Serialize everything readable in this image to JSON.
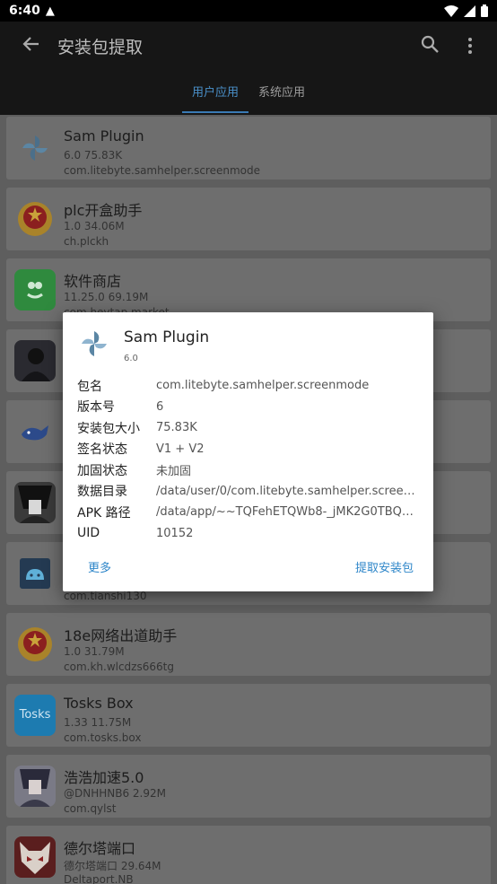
{
  "status_bar": {
    "time": "6:40"
  },
  "app_bar": {
    "title": "安装包提取"
  },
  "tabs": [
    {
      "label": "用户应用",
      "active": true
    },
    {
      "label": "系统应用",
      "active": false
    }
  ],
  "apps": [
    {
      "name": "Sam Plugin",
      "version_size": "6.0  75.83K",
      "package": "com.litebyte.samhelper.screenmode",
      "icon": "pinwheel-icon"
    },
    {
      "name": "plc开盒助手",
      "version_size": "1.0  34.06M",
      "package": "ch.plckh",
      "icon": "emblem-icon"
    },
    {
      "name": "软件商店",
      "version_size": "11.25.0  69.19M",
      "package": "com.heytap.market",
      "icon": "store-icon"
    },
    {
      "name": "",
      "version_size": "",
      "package": "",
      "icon": "avatar-icon"
    },
    {
      "name": "",
      "version_size": "",
      "package": "",
      "icon": "whale-icon"
    },
    {
      "name": "",
      "version_size": "",
      "package": "",
      "icon": "anime-avatar-icon"
    },
    {
      "name": "",
      "version_size": "",
      "package": "com.tianshi130",
      "icon": "android-icon"
    },
    {
      "name": "18e网络出道助手",
      "version_size": "1.0  31.79M",
      "package": "com.kh.wlcdzs666tg",
      "icon": "emblem-icon"
    },
    {
      "name": "Tosks Box",
      "version_size": "1.33  11.75M",
      "package": "com.tosks.box",
      "icon": "tosks-icon",
      "icon_text": "Tosks"
    },
    {
      "name": "浩浩加速5.0",
      "version_size": "@DNHHNB6  2.92M",
      "package": "com.qylst",
      "icon": "anime-avatar-icon"
    },
    {
      "name": "德尔塔端口",
      "version_size": "德尔塔端口  29.64M",
      "package": "Deltaport.NB",
      "icon": "fox-icon"
    }
  ],
  "dialog": {
    "title": "Sam Plugin",
    "version": "6.0",
    "rows": [
      {
        "key": "包名",
        "value": "com.litebyte.samhelper.screenmode"
      },
      {
        "key": "版本号",
        "value": "6"
      },
      {
        "key": "安装包大小",
        "value": "75.83K"
      },
      {
        "key": "签名状态",
        "value": "V1 + V2"
      },
      {
        "key": "加固状态",
        "value": "未加固"
      },
      {
        "key": "数据目录",
        "value": "/data/user/0/com.litebyte.samhelper.screen..."
      },
      {
        "key": "APK 路径",
        "value": "/data/app/~~TQFehETQWb8-_jMK2G0TBQ=..."
      },
      {
        "key": "UID",
        "value": "10152"
      }
    ],
    "more_label": "更多",
    "extract_label": "提取安装包"
  },
  "colors": {
    "accent": "#2e86c9",
    "tab_accent": "#4a90c9",
    "appbar": "#161616"
  }
}
